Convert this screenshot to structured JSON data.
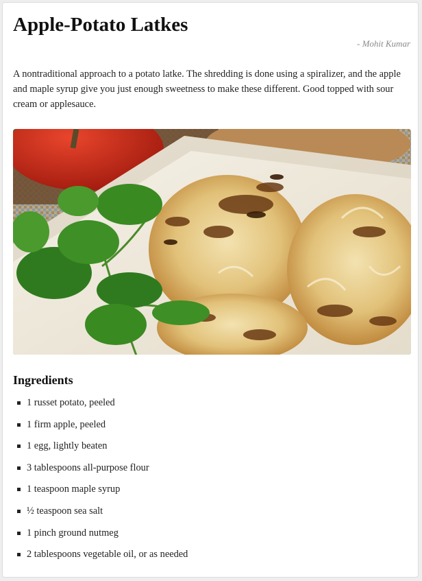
{
  "recipe": {
    "title": "Apple-Potato Latkes",
    "author": "- Mohit Kumar",
    "description": "A nontraditional approach to a potato latke. The shredding is done using a spiralizer, and the apple and maple syrup give you just enough sweetness to make these different. Good topped with sour cream or applesauce.",
    "ingredients_heading": "Ingredients",
    "ingredients": [
      "1 russet potato, peeled",
      "1 firm apple, peeled",
      "1 egg, lightly beaten",
      "3 tablespoons all-purpose flour",
      "1 teaspoon maple syrup",
      "½ teaspoon sea salt",
      "1 pinch ground nutmeg",
      "2 tablespoons vegetable oil, or as needed"
    ]
  }
}
